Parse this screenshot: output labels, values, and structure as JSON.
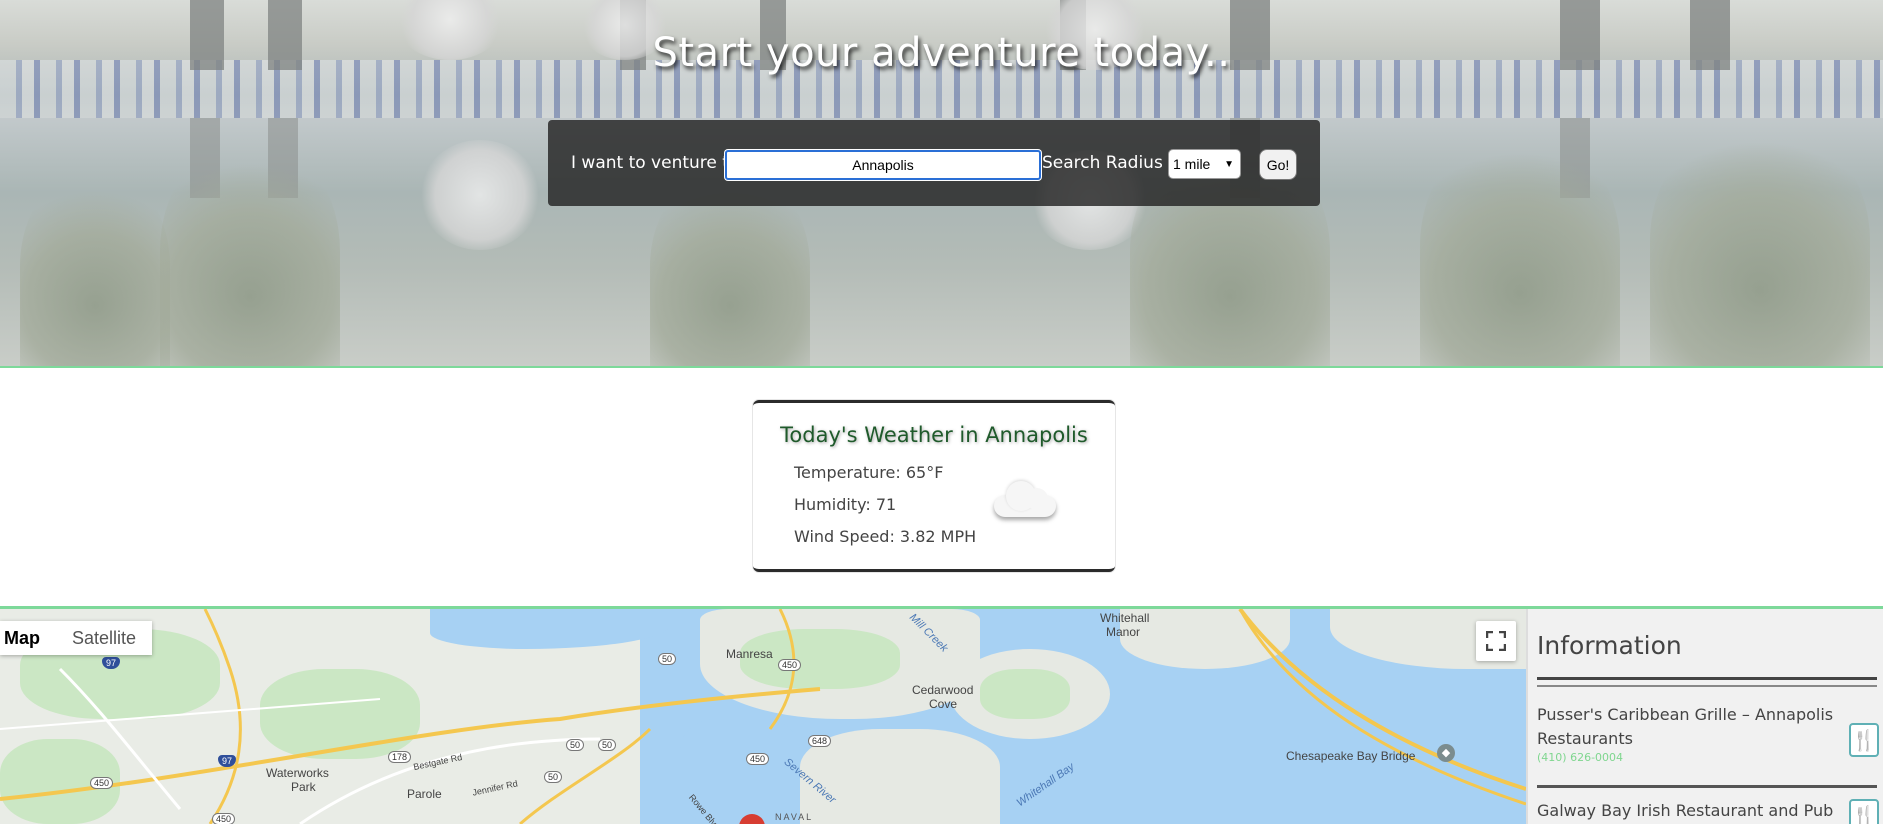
{
  "hero": {
    "title": "Start your adventure today..",
    "search": {
      "label": "I want to venture to",
      "value": "Annapolis",
      "radius_label": "Search Radius",
      "radius_value": "1 mile",
      "go_label": "Go!"
    }
  },
  "weather": {
    "title": "Today's Weather in Annapolis",
    "temperature": "Temperature: 65°F",
    "humidity": "Humidity: 71",
    "wind": "Wind Speed: 3.82 MPH",
    "icon": "cloud-icon"
  },
  "map": {
    "type_options": [
      "Map",
      "Satellite"
    ],
    "active_type": "Map",
    "labels": {
      "whitehall_manor_1": "Whitehall",
      "whitehall_manor_2": "Manor",
      "manresa": "Manresa",
      "cedarwood_1": "Cedarwood",
      "cedarwood_2": "Cove",
      "waterworks_1": "Waterworks",
      "waterworks_2": "Park",
      "parole": "Parole",
      "chesapeake_bay_bridge": "Chesapeake Bay Bridge",
      "mill_creek": "Mill Creek",
      "severn_river": "Severn River",
      "whitehall_bay": "Whitehall Bay",
      "naval": "NAVAL",
      "bestgate_rd": "Bestgate Rd",
      "jennifer_rd": "Jennifer Rd",
      "rowe_blvd": "Rowe Blvd"
    },
    "shields": [
      "97",
      "50",
      "450",
      "178",
      "50",
      "450",
      "648",
      "450",
      "50",
      "97",
      "450",
      "50"
    ]
  },
  "info": {
    "title": "Information",
    "places": [
      {
        "name": "Pusser's Caribbean Grille – Annapolis Restaurants",
        "phone": "(410) 626-0004"
      },
      {
        "name": "Galway Bay Irish Restaurant and Pub",
        "phone": ""
      }
    ]
  }
}
